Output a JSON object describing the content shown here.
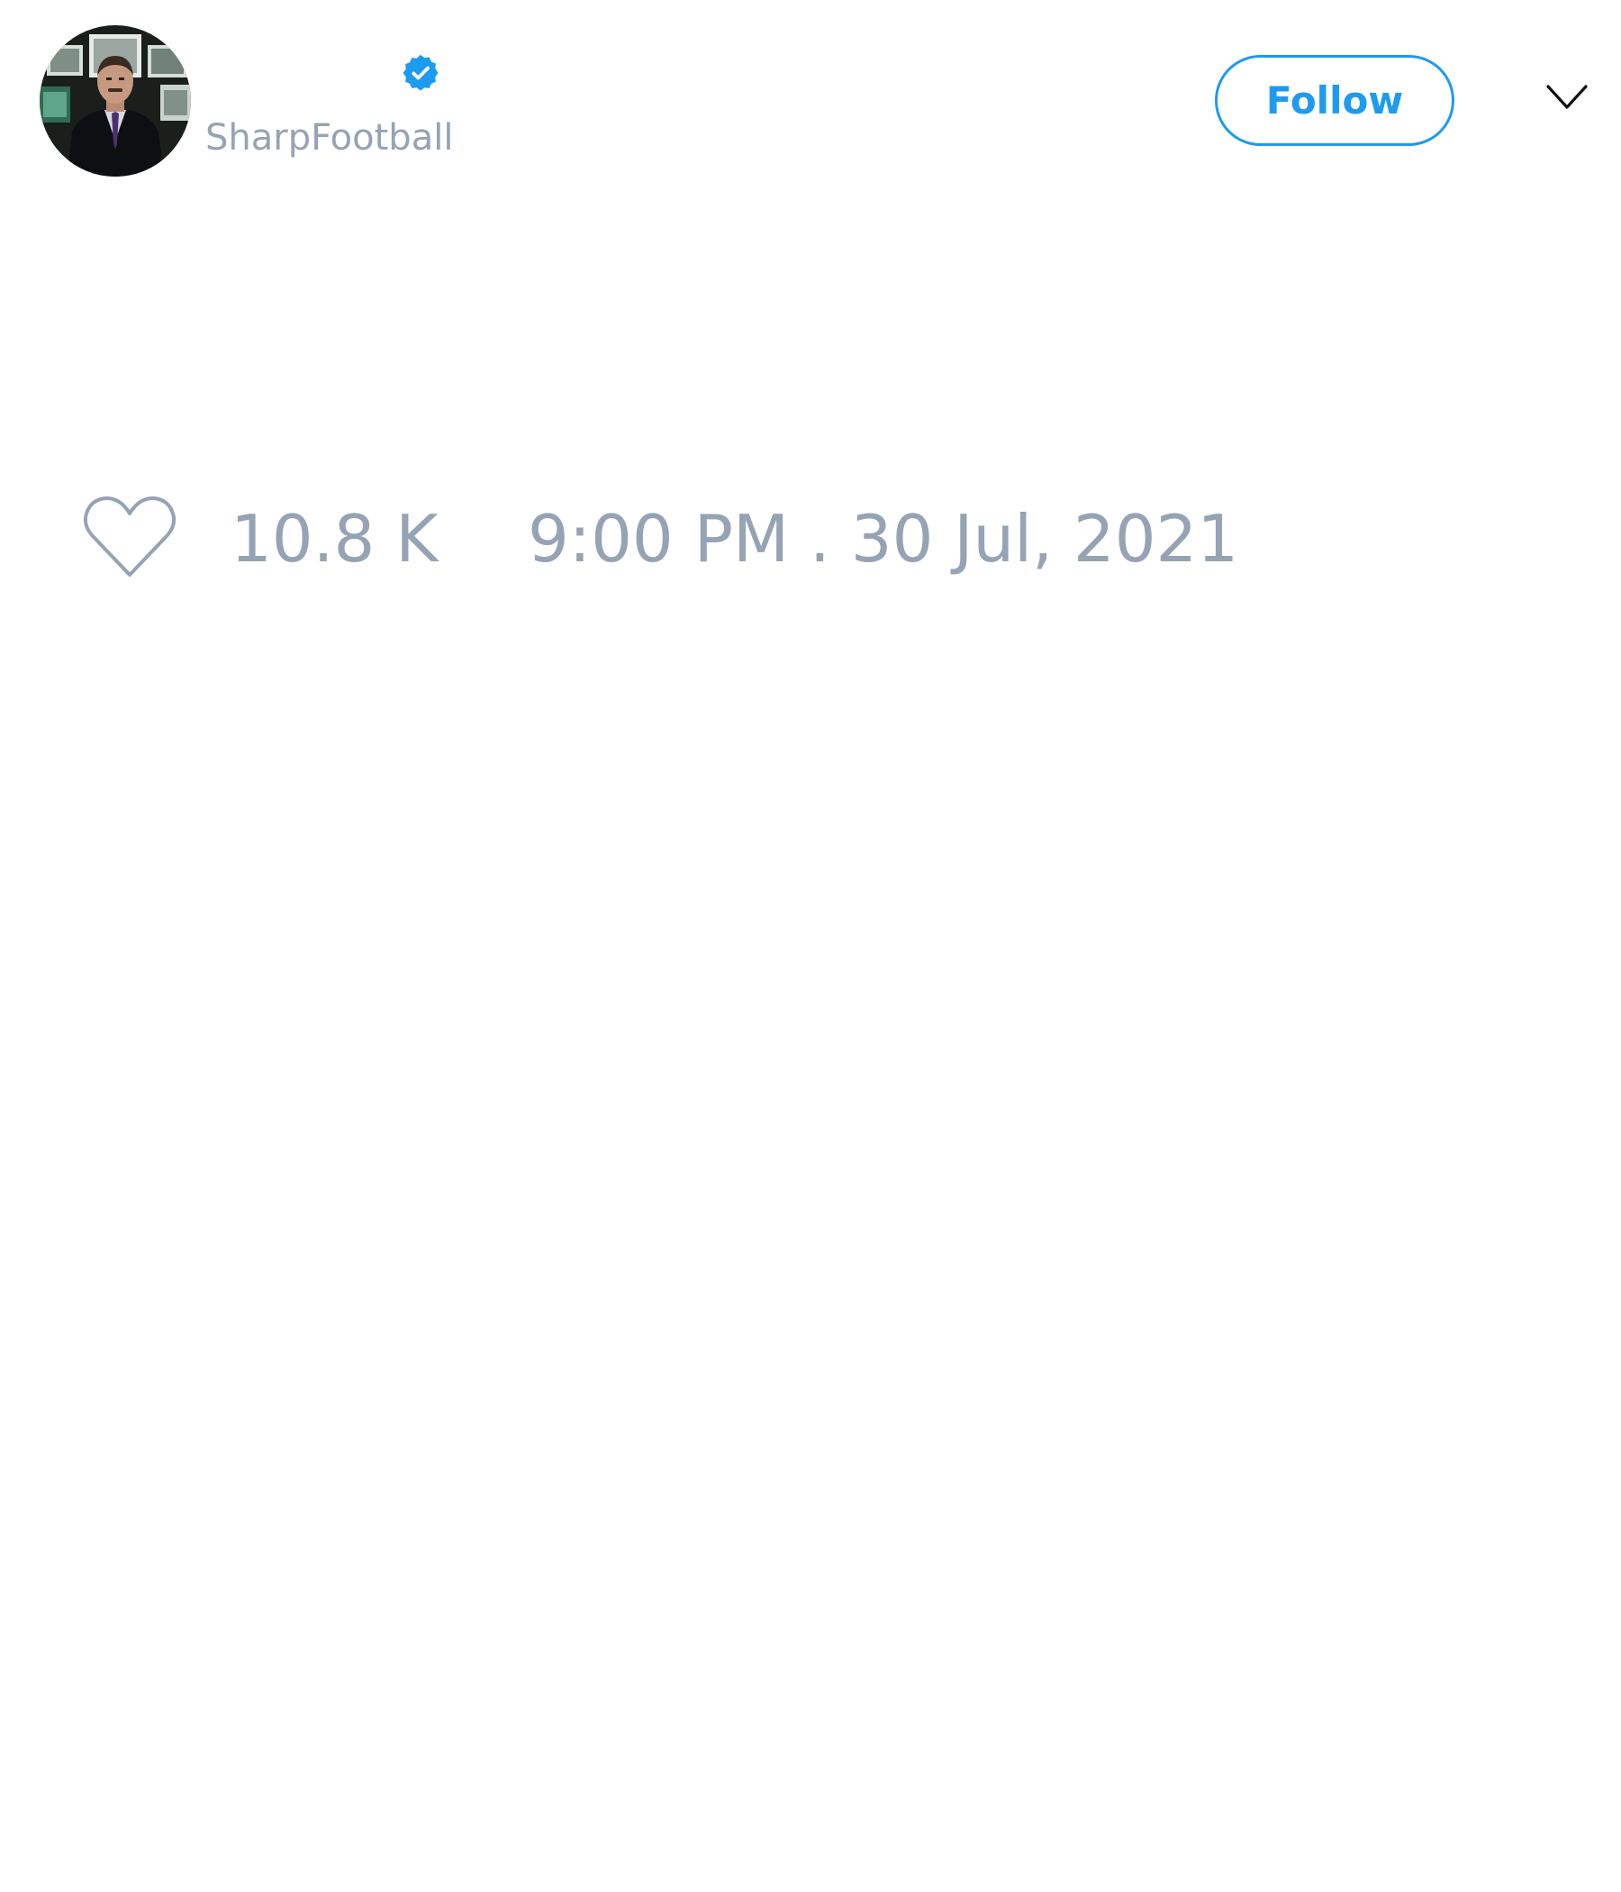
{
  "tweet": {
    "handle": "SharpFootball",
    "verified": true,
    "follow_label": "Follow",
    "like_count": "10.8 K",
    "timestamp": "9:00 PM . 30 Jul, 2021"
  },
  "icons": {
    "avatar": "avatar-photo",
    "verified": "verified-badge-icon",
    "menu": "chevron-down-icon",
    "like": "heart-icon"
  },
  "colors": {
    "accent": "#1d9bf0",
    "muted_text": "#95a3b5",
    "background": "#ffffff"
  }
}
